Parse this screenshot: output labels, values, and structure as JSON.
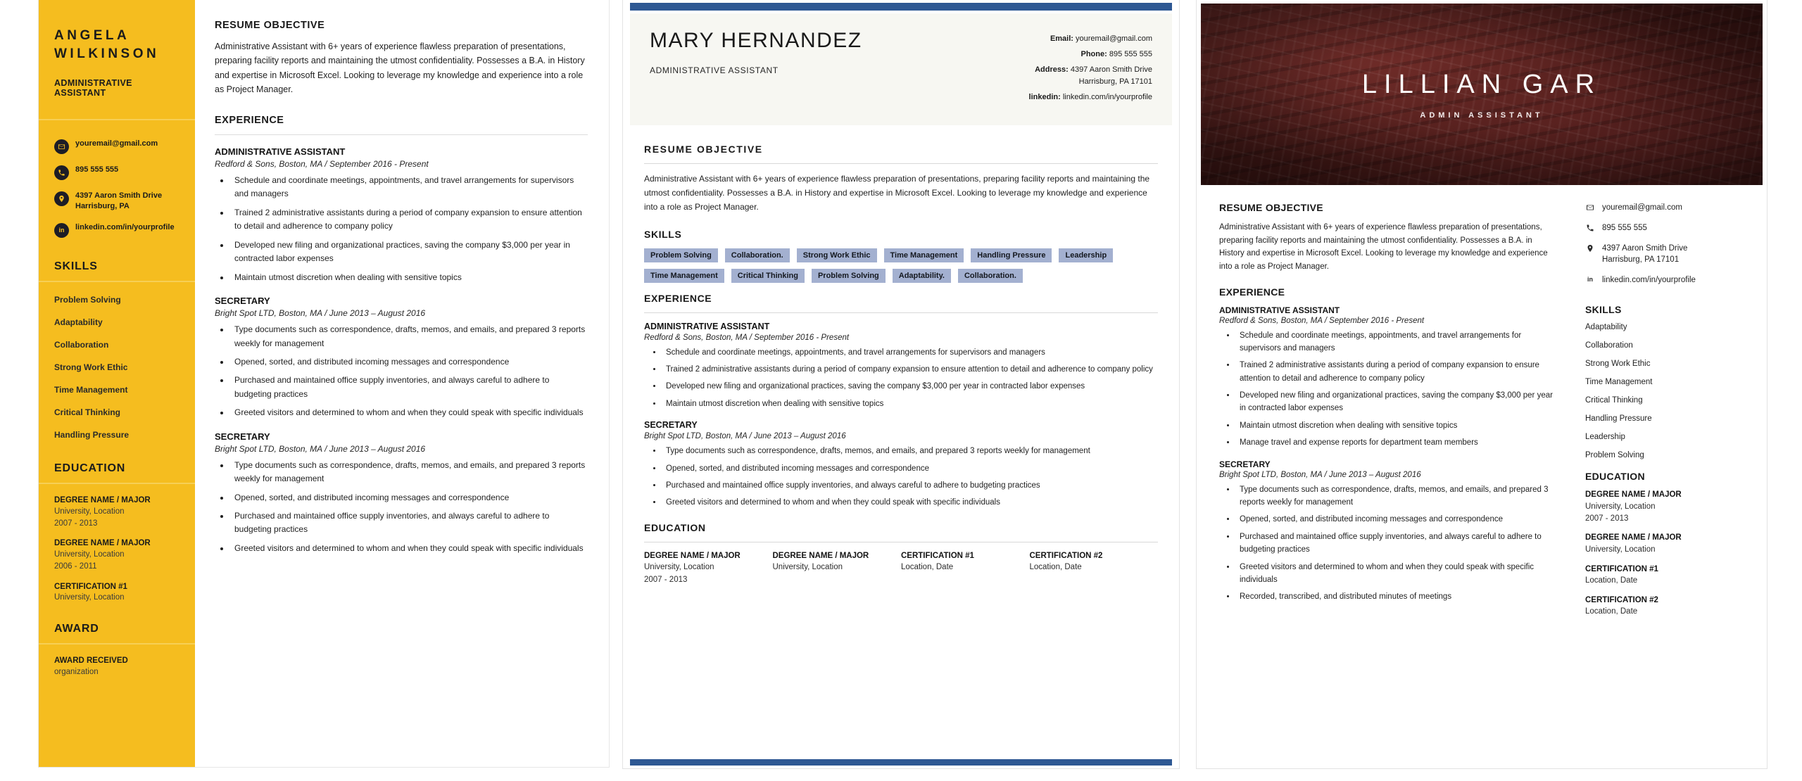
{
  "shared": {
    "objective_label": "RESUME OBJECTIVE",
    "experience_label": "EXPERIENCE",
    "skills_label": "SKILLS",
    "education_label": "EDUCATION",
    "objective_text": "Administrative Assistant with 6+ years of experience flawless preparation of presentations, preparing facility reports and maintaining the utmost confidentiality.  Possesses a B.A. in History and expertise in Microsoft Excel. Looking to leverage my knowledge and experience into a role as Project Manager.",
    "job1_title": "ADMINISTRATIVE ASSISTANT",
    "job1_meta": "Redford & Sons, Boston, MA  /  September 2016 - Present",
    "job2_title": "SECRETARY",
    "job2_meta": "Bright Spot LTD, Boston, MA  /  June 2013 – August 2016"
  },
  "resume1": {
    "accent_color": "#f5bd1f",
    "name_line1": "ANGELA",
    "name_line2": "WILKINSON",
    "role": "ADMINISTRATIVE ASSISTANT",
    "contacts": [
      {
        "icon": "email-icon",
        "text": "youremail@gmail.com"
      },
      {
        "icon": "phone-icon",
        "text": "895 555 555"
      },
      {
        "icon": "location-icon",
        "text": "4397 Aaron Smith Drive Harrisburg, PA"
      },
      {
        "icon": "linkedin-icon",
        "text": "linkedin.com/in/yourprofile"
      }
    ],
    "skills": [
      "Problem Solving",
      "Adaptability",
      "Collaboration",
      "Strong Work Ethic",
      "Time Management",
      "Critical Thinking",
      "Handling Pressure"
    ],
    "education": [
      {
        "title": "DEGREE NAME / MAJOR",
        "sub1": "University, Location",
        "sub2": "2007 - 2013"
      },
      {
        "title": "DEGREE NAME / MAJOR",
        "sub1": "University, Location",
        "sub2": "2006 - 2011"
      },
      {
        "title": "CERTIFICATION #1",
        "sub1": "University, Location",
        "sub2": ""
      }
    ],
    "award_label": "AWARD",
    "award": {
      "title": "AWARD RECEIVED",
      "sub1": "organization"
    },
    "job1_bullets": [
      "Schedule and coordinate meetings, appointments, and travel arrangements for supervisors and managers",
      "Trained 2 administrative assistants during a period of company expansion to ensure attention to detail and adherence to company policy",
      "Developed new filing and organizational practices, saving the company $3,000 per year in contracted labor expenses",
      "Maintain utmost discretion when dealing with sensitive topics"
    ],
    "job2_bullets": [
      "Type documents such as correspondence, drafts, memos, and emails, and prepared 3 reports weekly for management",
      "Opened, sorted, and distributed incoming messages and correspondence",
      "Purchased and maintained office supply inventories, and always careful to adhere to budgeting practices",
      "Greeted visitors and determined to whom and when they could speak with specific individuals"
    ],
    "job3_bullets": [
      "Type documents such as correspondence, drafts, memos, and emails, and prepared 3 reports weekly for management",
      "Opened, sorted, and distributed incoming messages and correspondence",
      "Purchased and maintained office supply inventories, and always careful to adhere to budgeting practices",
      "Greeted visitors and determined to whom and when they could speak with specific individuals"
    ]
  },
  "resume2": {
    "accent_color": "#2e5893",
    "tag_color": "#a3b0d0",
    "name": "MARY  HERNANDEZ",
    "role": "ADMINISTRATIVE ASSISTANT",
    "contacts": [
      {
        "label": "Email:",
        "value": "youremail@gmail.com"
      },
      {
        "label": "Phone:",
        "value": "895 555 555"
      },
      {
        "label": "Address:",
        "value": "4397 Aaron Smith  Drive",
        "value2": "Harrisburg, PA 17101"
      },
      {
        "label": "linkedin:",
        "value": "linkedin.com/in/yourprofile"
      }
    ],
    "skills": [
      "Problem Solving",
      "Collaboration.",
      "Strong Work Ethic",
      "Time Management",
      "Handling Pressure",
      "Leadership",
      "Time Management",
      "Critical Thinking",
      "Problem Solving",
      "Adaptability.",
      "Collaboration."
    ],
    "job1_bullets": [
      "Schedule and coordinate meetings, appointments, and travel arrangements for supervisors and managers",
      "Trained 2 administrative assistants during a period of company expansion to ensure attention to detail and adherence to company policy",
      "Developed new filing and organizational practices, saving the company $3,000 per year in contracted labor expenses",
      "Maintain utmost discretion when dealing with sensitive topics"
    ],
    "job2_bullets": [
      "Type documents such as correspondence, drafts, memos, and emails, and prepared 3 reports weekly for management",
      "Opened, sorted, and distributed incoming messages and correspondence",
      "Purchased and maintained office supply inventories, and always careful to adhere to budgeting practices",
      "Greeted visitors and determined to whom and when they could speak with specific individuals"
    ],
    "education": [
      {
        "title": "DEGREE NAME / MAJOR",
        "sub1": "University, Location",
        "sub2": "2007 - 2013"
      },
      {
        "title": "DEGREE NAME / MAJOR",
        "sub1": "University, Location",
        "sub2": ""
      },
      {
        "title": "CERTIFICATION #1",
        "sub1": "Location, Date",
        "sub2": ""
      },
      {
        "title": "CERTIFICATION #2",
        "sub1": "Location, Date",
        "sub2": ""
      }
    ]
  },
  "resume3": {
    "accent_color": "#4a1c1c",
    "name": "LILLIAN GAR",
    "role": "ADMIN ASSISTANT",
    "contacts": [
      {
        "icon": "email-icon",
        "text": "youremail@gmail.com"
      },
      {
        "icon": "phone-icon",
        "text": "895 555 555"
      },
      {
        "icon": "location-icon",
        "text": "4397 Aaron Smith Drive",
        "text2": "Harrisburg, PA 17101"
      },
      {
        "icon": "linkedin-icon",
        "text": "linkedin.com/in/yourprofile"
      }
    ],
    "skills": [
      "Adaptability",
      "Collaboration",
      "Strong Work Ethic",
      "Time Management",
      "Critical Thinking",
      "Handling Pressure",
      "Leadership",
      "Problem Solving"
    ],
    "education": [
      {
        "title": "DEGREE NAME / MAJOR",
        "sub1": "University, Location",
        "sub2": "2007 - 2013"
      },
      {
        "title": "DEGREE NAME / MAJOR",
        "sub1": "University, Location",
        "sub2": ""
      },
      {
        "title": "CERTIFICATION #1",
        "sub1": "Location, Date",
        "sub2": ""
      },
      {
        "title": "CERTIFICATION #2",
        "sub1": "Location, Date",
        "sub2": ""
      }
    ],
    "job1_bullets": [
      "Schedule and coordinate meetings, appointments, and travel arrangements for supervisors and managers",
      "Trained 2 administrative assistants during a period of company expansion to ensure attention to detail and adherence to company policy",
      "Developed new filing and organizational practices, saving the company $3,000 per year in contracted labor expenses",
      "Maintain utmost discretion when dealing with sensitive topics",
      "Manage travel and expense reports for department team members"
    ],
    "job2_bullets": [
      "Type documents such as correspondence, drafts, memos, and emails, and prepared 3 reports weekly for management",
      "Opened, sorted, and distributed incoming messages and correspondence",
      "Purchased and maintained office supply inventories, and always careful to adhere to budgeting practices",
      "Greeted visitors and determined to whom and when they could speak with specific individuals",
      "Recorded, transcribed, and distributed minutes of meetings"
    ]
  }
}
